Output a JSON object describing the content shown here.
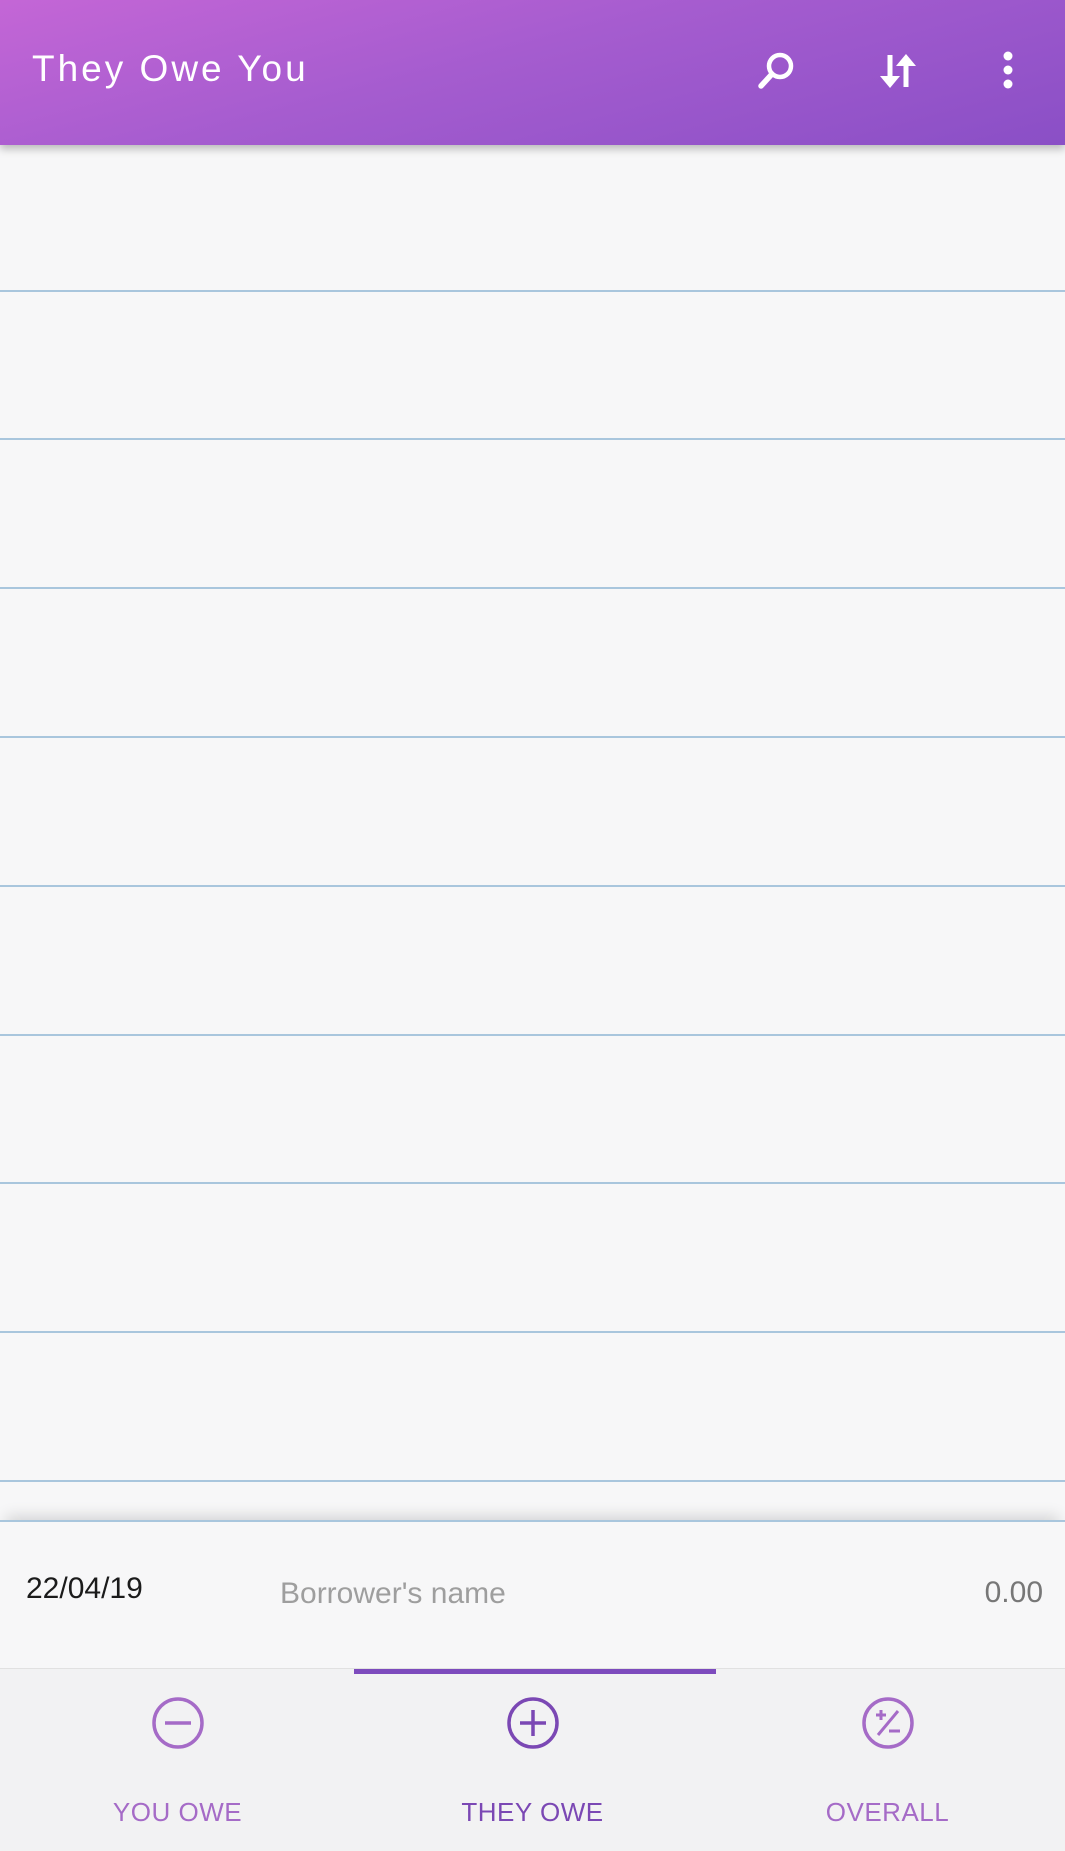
{
  "app_bar": {
    "title": "They Owe You",
    "background_colors": [
      "#c466d6",
      "#8a4fc6"
    ],
    "actions": [
      {
        "name": "search",
        "icon": "search-icon"
      },
      {
        "name": "sort",
        "icon": "sort-arrows-icon"
      },
      {
        "name": "more",
        "icon": "more-vert-icon"
      }
    ]
  },
  "list": {
    "rule_color": "#a9c6dd",
    "rows": []
  },
  "entry": {
    "date": "22/04/19",
    "name_value": "",
    "name_placeholder": "Borrower's name",
    "amount": "0.00"
  },
  "bottom_nav": {
    "accent_color": "#7d4bbd",
    "tabs": [
      {
        "label": "YOU OWE",
        "icon": "minus-circle-icon",
        "active": false
      },
      {
        "label": "THEY OWE",
        "icon": "plus-circle-icon",
        "active": true
      },
      {
        "label": "OVERALL",
        "icon": "plus-minus-circle-icon",
        "active": false
      }
    ]
  }
}
